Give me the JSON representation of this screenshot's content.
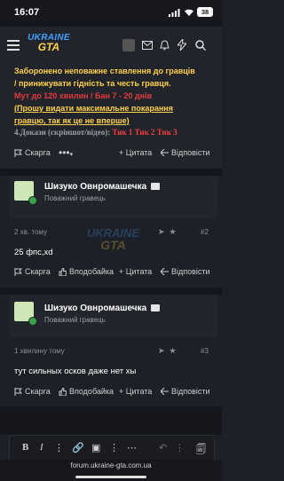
{
  "status": {
    "time": "16:07",
    "battery": "38"
  },
  "header": {
    "logo_top": "UKRAINE",
    "logo_bottom": "GTA"
  },
  "post1": {
    "line1": "Заборонено неповажне ставлення до гравців",
    "line2": "/ принижувати гідність та честь гравця.",
    "line3_red": "Мут до 120 хвилин / Бан 7 - 20 днів",
    "line4": "(Прошу видати максимальне покарання",
    "line5": "гравцю, так як це не вперше)",
    "evidence_label": "4.Докази (скріншот/відео):",
    "evidence_links": "Тик 1 Тик 2 Тик 3",
    "report": "Скарга",
    "quote": "+ Цитата",
    "reply": "Відповісти"
  },
  "post2": {
    "username": "Шизуко Овнромашечка",
    "user_title": "Поважний гравець",
    "time": "2 хв. тому",
    "number": "#2",
    "message": "25 фпс,xd",
    "report": "Скарга",
    "like": "Вподобайка",
    "quote": "+ Цитата",
    "reply": "Відповісти"
  },
  "post3": {
    "username": "Шизуко Овнромашечка",
    "user_title": "Поважний гравець",
    "time": "1 хвилину тому",
    "number": "#3",
    "message": "тут сильных осков даже нет хы",
    "report": "Скарга",
    "like": "Вподобайка",
    "quote": "+ Цитата",
    "reply": "Відповісти"
  },
  "browser": {
    "url": "forum.ukraine-gta.com.ua"
  },
  "colors": {
    "accent_yellow": "#ffd24a",
    "rule_red": "#e23b3b",
    "link_red": "#ff3b3b",
    "badge_green": "#3aa34a"
  }
}
